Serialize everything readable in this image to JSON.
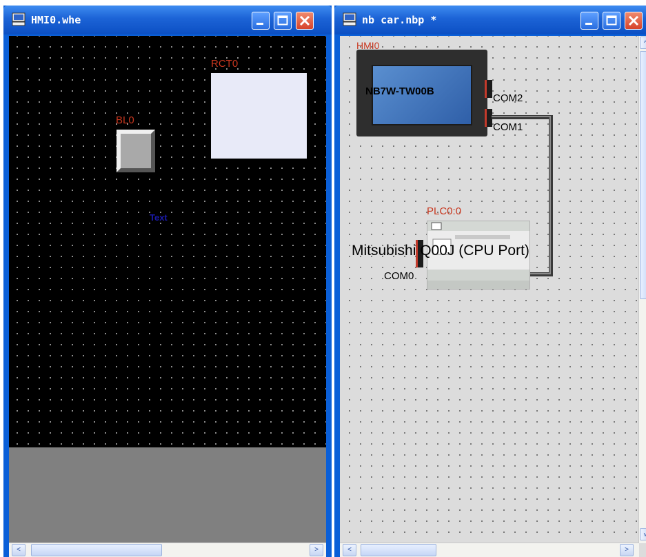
{
  "left_window": {
    "title": "HMI0.whe",
    "objects": {
      "rect_label": "RCT0",
      "bitlamp_label": "BL0",
      "text_label": "Text"
    }
  },
  "right_window": {
    "title": "nb car.nbp *",
    "hmi": {
      "label": "HMI0",
      "model": "NB7W-TW00B",
      "port_com2": "COM2",
      "port_com1": "COM1"
    },
    "plc": {
      "label": "PLC0:0",
      "model": "Mitsubishi Q00J (CPU Port)",
      "port_com0": "COM0"
    }
  },
  "scrollbar": {
    "left_arrow": "<",
    "right_arrow": ">",
    "up_arrow": "^",
    "down_arrow": "v"
  },
  "colors": {
    "title_bar": "#1c63d6",
    "label_red": "#c8361e",
    "text_blue": "#1a1aa8",
    "close_button": "#d6432a"
  },
  "icons": [
    "app-icon",
    "minimize-icon",
    "maximize-icon",
    "close-icon"
  ]
}
